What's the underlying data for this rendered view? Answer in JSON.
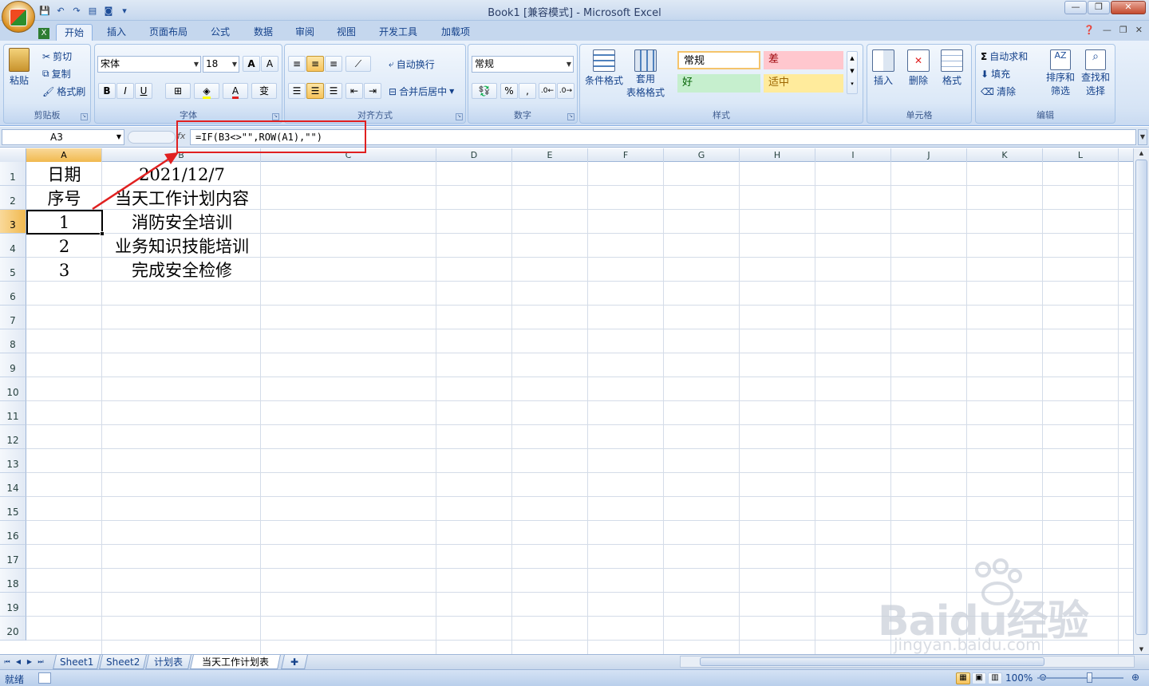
{
  "window": {
    "title": "Book1  [兼容模式] - Microsoft Excel"
  },
  "tabs": [
    "开始",
    "插入",
    "页面布局",
    "公式",
    "数据",
    "审阅",
    "视图",
    "开发工具",
    "加载项"
  ],
  "ribbon": {
    "clipboard": {
      "label": "剪贴板",
      "paste": "粘贴",
      "cut": "剪切",
      "copy": "复制",
      "format_painter": "格式刷"
    },
    "font": {
      "label": "字体",
      "name": "宋体",
      "size": "18",
      "bold": "B",
      "italic": "I",
      "underline": "U"
    },
    "alignment": {
      "label": "对齐方式",
      "wrap": "自动换行",
      "merge": "合并后居中"
    },
    "number": {
      "label": "数字",
      "format": "常规",
      "percent": "%",
      "comma": ","
    },
    "styles": {
      "label": "样式",
      "cond_format": "条件格式",
      "table_format": "套用",
      "table_format2": "表格格式",
      "normal": "常规",
      "bad": "差",
      "good": "好",
      "neutral": "适中"
    },
    "cells": {
      "label": "单元格",
      "insert": "插入",
      "delete": "删除",
      "format": "格式"
    },
    "editing": {
      "label": "编辑",
      "autosum": "自动求和",
      "fill": "填充",
      "clear": "清除",
      "sort": "排序和",
      "sort2": "筛选",
      "find": "查找和",
      "find2": "选择"
    }
  },
  "formula_bar": {
    "name_box": "A3",
    "fx": "fx",
    "formula": "=IF(B3<>\"\",ROW(A1),\"\")"
  },
  "columns": [
    "A",
    "B",
    "C",
    "D",
    "E",
    "F",
    "G",
    "H",
    "I",
    "J",
    "K",
    "L"
  ],
  "rows": [
    "1",
    "2",
    "3",
    "4",
    "5",
    "6",
    "7",
    "8",
    "9",
    "10",
    "11",
    "12",
    "13",
    "14",
    "15",
    "16",
    "17",
    "18",
    "19",
    "20"
  ],
  "cells": {
    "A1": "日期",
    "B1": "2021/12/7",
    "A2": "序号",
    "B2": "当天工作计划内容",
    "A3": "1",
    "B3": "消防安全培训",
    "A4": "2",
    "B4": "业务知识技能培训",
    "A5": "3",
    "B5": "完成安全检修"
  },
  "sheets": [
    "Sheet1",
    "Sheet2",
    "计划表",
    "当天工作计划表"
  ],
  "status": {
    "mode": "就绪",
    "zoom": "100%"
  },
  "watermark": {
    "brand": "Baidu经验",
    "url": "jingyan.baidu.com"
  }
}
